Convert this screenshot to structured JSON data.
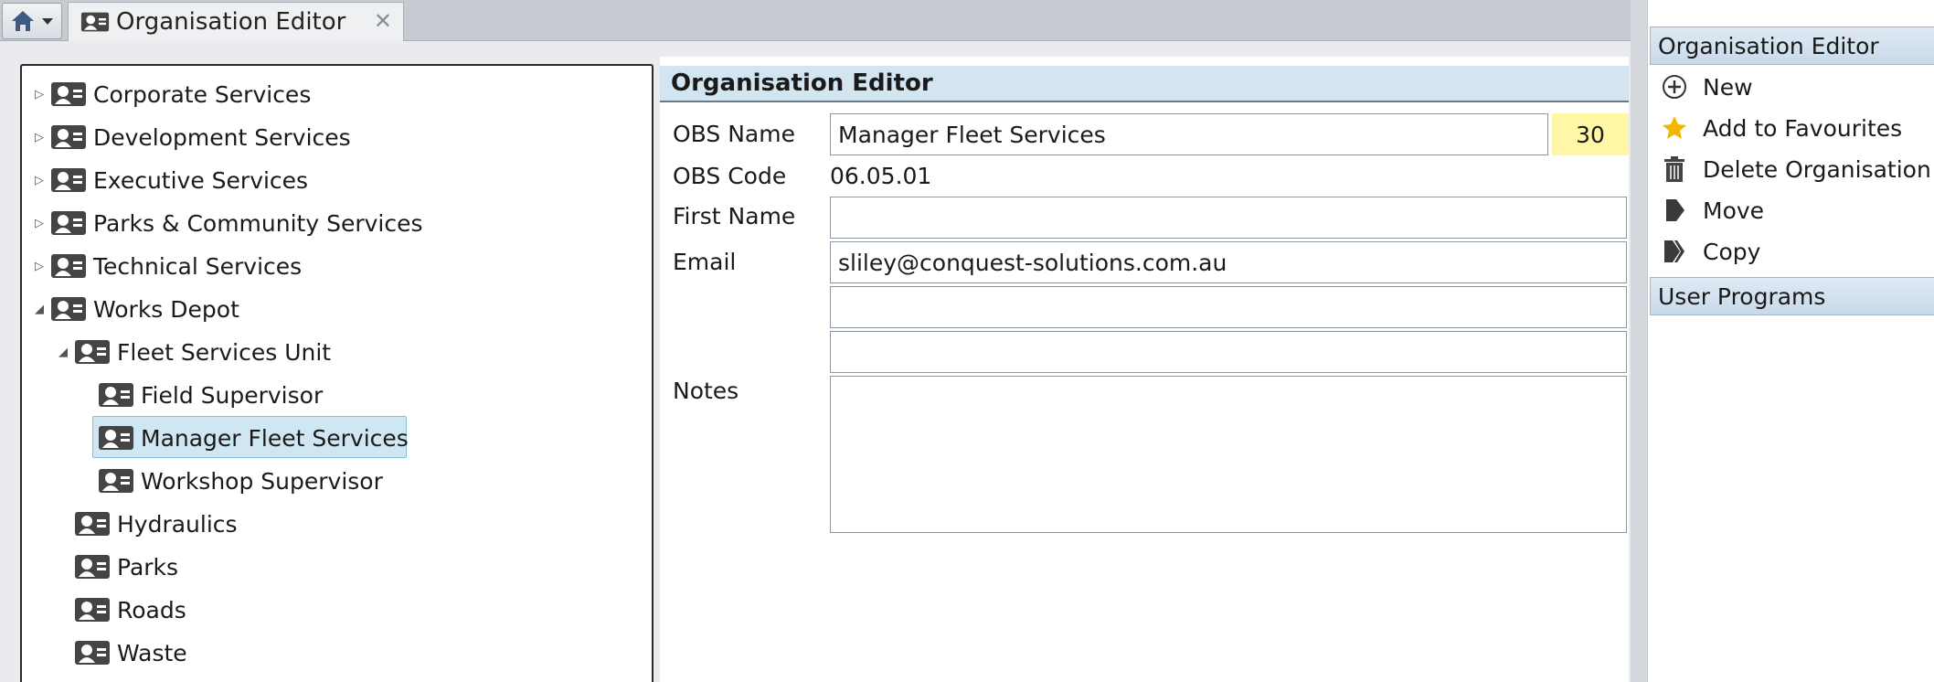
{
  "tab": {
    "label": "Organisation Editor"
  },
  "tree": {
    "nodes": [
      {
        "label": "Corporate Services"
      },
      {
        "label": "Development Services"
      },
      {
        "label": "Executive Services"
      },
      {
        "label": "Parks & Community Services"
      },
      {
        "label": "Technical Services"
      },
      {
        "label": "Works Depot"
      },
      {
        "label": "Fleet Services Unit"
      },
      {
        "label": "Field Supervisor"
      },
      {
        "label": "Manager Fleet Services"
      },
      {
        "label": "Workshop Supervisor"
      },
      {
        "label": "Hydraulics"
      },
      {
        "label": "Parks"
      },
      {
        "label": "Roads"
      },
      {
        "label": "Waste"
      }
    ]
  },
  "form": {
    "title": "Organisation Editor",
    "obs_name_label": "OBS Name",
    "obs_name_value": "Manager Fleet Services",
    "obs_count": "30",
    "obs_code_label": "OBS Code",
    "obs_code_value": "06.05.01",
    "first_name_label": "First Name",
    "first_name_value": "",
    "email_label": "Email",
    "email_value": "sliley@conquest-solutions.com.au",
    "extra1_value": "",
    "extra2_value": "",
    "notes_label": "Notes",
    "notes_value": ""
  },
  "actions": {
    "header": "Organisation Editor",
    "items": [
      {
        "label": "New",
        "icon": "add-circle-icon"
      },
      {
        "label": "Add to Favourites",
        "icon": "star-icon"
      },
      {
        "label": "Delete Organisation",
        "icon": "trash-icon"
      },
      {
        "label": "Move",
        "icon": "move-icon"
      },
      {
        "label": "Copy",
        "icon": "copy-icon"
      }
    ],
    "section2_header": "User Programs"
  },
  "colors": {
    "selection_bg": "#cfe6f3",
    "header_bg": "#d3e5f1",
    "count_badge_bg": "#fff7a6",
    "star": "#f2b800"
  }
}
